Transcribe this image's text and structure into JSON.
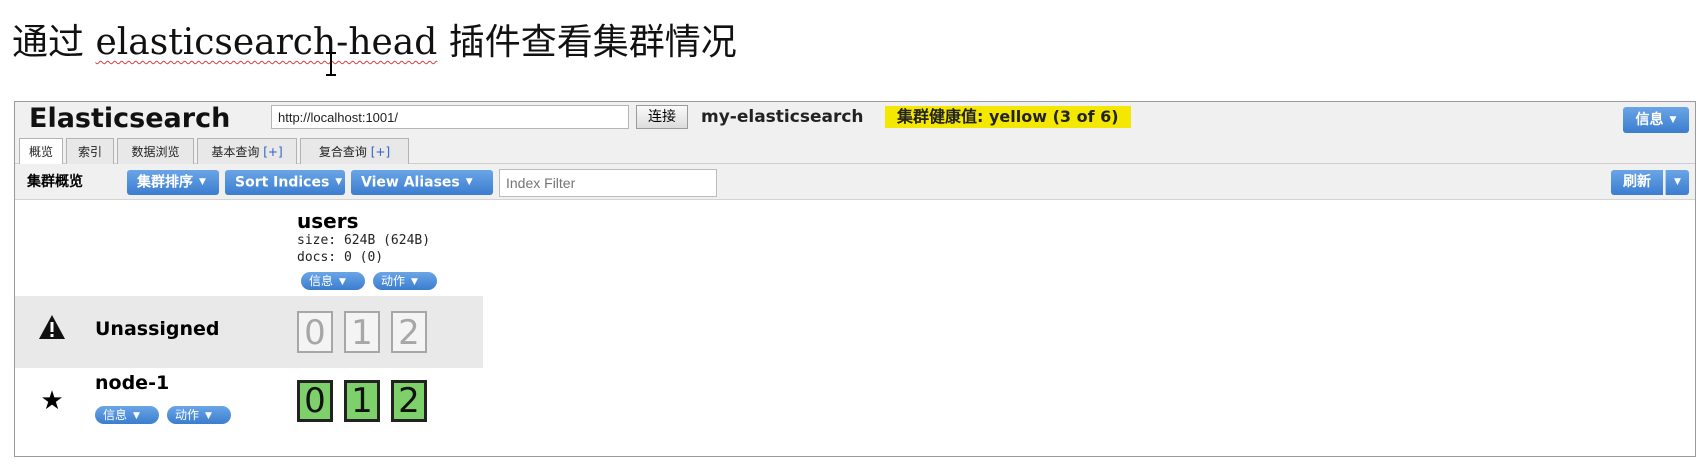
{
  "heading": {
    "prefix": "通过 ",
    "squiggle_text": "elasticsearch-head",
    "suffix": " 插件查看集群情况"
  },
  "header": {
    "app_title": "Elasticsearch",
    "url_value": "http://localhost:1001/",
    "connect_label": "连接",
    "cluster_name": "my-elasticsearch",
    "health_text": "集群健康值: yellow (3 of 6)",
    "health_color": "#f5e800",
    "info_label": "信息"
  },
  "tabs": [
    {
      "label": "概览",
      "active": true
    },
    {
      "label": "索引"
    },
    {
      "label": "数据浏览"
    },
    {
      "label": "基本查询",
      "plus": "[+]"
    },
    {
      "label": "复合查询",
      "plus": "[+]"
    }
  ],
  "toolbar": {
    "label": "集群概览",
    "sort_cluster": "集群排序",
    "sort_indices": "Sort Indices",
    "view_aliases": "View Aliases",
    "index_filter_placeholder": "Index Filter",
    "refresh_label": "刷新"
  },
  "index": {
    "name": "users",
    "size": "size: 624B (624B)",
    "docs": "docs: 0 (0)",
    "info_label": "信息",
    "action_label": "动作"
  },
  "rows": {
    "unassigned": {
      "icon": "warning-icon",
      "label": "Unassigned",
      "shards": [
        "0",
        "1",
        "2"
      ]
    },
    "node": {
      "icon": "star-icon",
      "label": "node-1",
      "info_label": "信息",
      "action_label": "动作",
      "shards": [
        "0",
        "1",
        "2"
      ]
    }
  },
  "colors": {
    "button_blue": "#3b7dcf",
    "shard_green": "#7ed06a"
  }
}
